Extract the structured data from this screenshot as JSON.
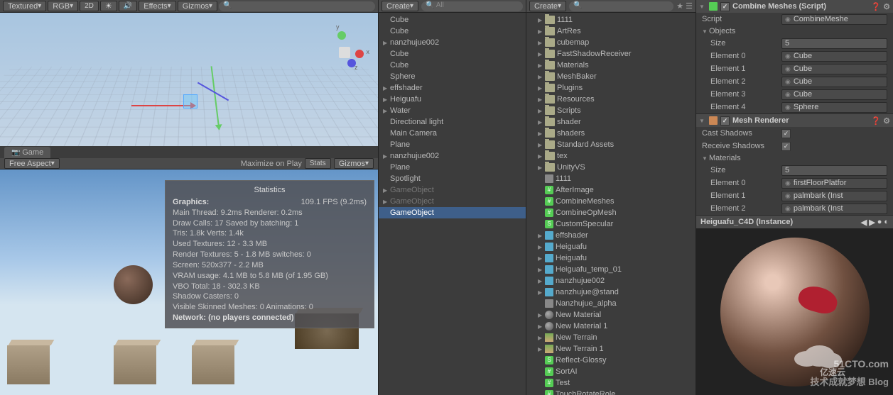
{
  "scene_toolbar": {
    "shading": "Textured",
    "render": "RGB",
    "dim": "2D",
    "effects": "Effects",
    "gizmos": "Gizmos",
    "search_ph": "All"
  },
  "game_tab": "Game",
  "game_toolbar": {
    "aspect": "Free Aspect",
    "maximize": "Maximize on Play",
    "stats": "Stats",
    "gizmos": "Gizmos"
  },
  "stats": {
    "title": "Statistics",
    "graphics_hdr": "Graphics:",
    "fps": "109.1 FPS (9.2ms)",
    "main_thread": "Main Thread: 9.2ms   Renderer: 0.2ms",
    "draw_calls": "Draw Calls: 17    Saved by batching: 1",
    "tris": "Tris: 1.8k    Verts: 1.4k",
    "textures": "Used Textures: 12 - 3.3 MB",
    "render_tex": "Render Textures: 5 - 1.8 MB  switches: 0",
    "screen": "Screen: 520x377 - 2.2 MB",
    "vram": "VRAM usage: 4.1 MB to 5.8 MB (of 1.95 GB)",
    "vbo": "VBO Total: 18 - 302.3 KB",
    "shadow": "Shadow Casters: 0",
    "skinned": "Visible Skinned Meshes: 0      Animations: 0",
    "network": "Network: (no players connected)"
  },
  "hier_create": "Create",
  "hierarchy": [
    {
      "n": "Cube",
      "a": ""
    },
    {
      "n": "Cube",
      "a": ""
    },
    {
      "n": "nanzhujue002",
      "a": "▶"
    },
    {
      "n": "Cube",
      "a": ""
    },
    {
      "n": "Cube",
      "a": ""
    },
    {
      "n": "Sphere",
      "a": ""
    },
    {
      "n": "effshader",
      "a": "▶"
    },
    {
      "n": "Heiguafu",
      "a": "▶"
    },
    {
      "n": "Water",
      "a": "▶"
    },
    {
      "n": "Directional light",
      "a": ""
    },
    {
      "n": "Main Camera",
      "a": ""
    },
    {
      "n": "Plane",
      "a": ""
    },
    {
      "n": "nanzhujue002",
      "a": "▶"
    },
    {
      "n": "Plane",
      "a": ""
    },
    {
      "n": "Spotlight",
      "a": ""
    },
    {
      "n": "GameObject",
      "a": "▶",
      "d": 1
    },
    {
      "n": "GameObject",
      "a": "▶",
      "d": 1
    },
    {
      "n": "GameObject",
      "a": "",
      "sel": 1
    }
  ],
  "proj_create": "Create",
  "project": [
    {
      "n": "1111",
      "t": "f",
      "a": "▶"
    },
    {
      "n": "ArtRes",
      "t": "f",
      "a": "▶"
    },
    {
      "n": "cubemap",
      "t": "f",
      "a": "▶"
    },
    {
      "n": "FastShadowReceiver",
      "t": "f",
      "a": "▶"
    },
    {
      "n": "Materials",
      "t": "f",
      "a": "▶"
    },
    {
      "n": "MeshBaker",
      "t": "f",
      "a": "▶"
    },
    {
      "n": "Plugins",
      "t": "f",
      "a": "▶"
    },
    {
      "n": "Resources",
      "t": "f",
      "a": "▶"
    },
    {
      "n": "Scripts",
      "t": "f",
      "a": "▶"
    },
    {
      "n": "shader",
      "t": "f",
      "a": "▶"
    },
    {
      "n": "shaders",
      "t": "f",
      "a": "▶"
    },
    {
      "n": "Standard Assets",
      "t": "f",
      "a": "▶"
    },
    {
      "n": "tex",
      "t": "f",
      "a": "▶"
    },
    {
      "n": "UnityVS",
      "t": "f",
      "a": "▶"
    },
    {
      "n": "1111",
      "t": "scene",
      "a": ""
    },
    {
      "n": "AfterImage",
      "t": "s",
      "a": ""
    },
    {
      "n": "CombineMeshes",
      "t": "s",
      "a": ""
    },
    {
      "n": "CombineOpMesh",
      "t": "s",
      "a": ""
    },
    {
      "n": "CustomSpecular",
      "t": "sh",
      "a": ""
    },
    {
      "n": "effshader",
      "t": "pf",
      "a": "▶"
    },
    {
      "n": "Heiguafu",
      "t": "pf",
      "a": "▶"
    },
    {
      "n": "Heiguafu",
      "t": "pf",
      "a": "▶"
    },
    {
      "n": "Heiguafu_temp_01",
      "t": "pf",
      "a": "▶"
    },
    {
      "n": "nanzhujue002",
      "t": "pf",
      "a": "▶"
    },
    {
      "n": "nanzhujue@stand",
      "t": "pf",
      "a": "▶"
    },
    {
      "n": "Nanzhujue_alpha",
      "t": "img",
      "a": ""
    },
    {
      "n": "New Material",
      "t": "mat",
      "a": "▶"
    },
    {
      "n": "New Material 1",
      "t": "mat",
      "a": "▶"
    },
    {
      "n": "New Terrain",
      "t": "ter",
      "a": "▶"
    },
    {
      "n": "New Terrain 1",
      "t": "ter",
      "a": "▶"
    },
    {
      "n": "Reflect-Glossy",
      "t": "sh",
      "a": ""
    },
    {
      "n": "SortAI",
      "t": "s",
      "a": ""
    },
    {
      "n": "Test",
      "t": "s",
      "a": ""
    },
    {
      "n": "TouchRotateRole",
      "t": "s",
      "a": ""
    }
  ],
  "inspector": {
    "comp1": {
      "title": "Combine Meshes (Script)",
      "script_lbl": "Script",
      "script_val": "CombineMeshe",
      "objects": "Objects",
      "size_lbl": "Size",
      "size_val": "5",
      "els": [
        [
          "Element 0",
          "Cube"
        ],
        [
          "Element 1",
          "Cube"
        ],
        [
          "Element 2",
          "Cube"
        ],
        [
          "Element 3",
          "Cube"
        ],
        [
          "Element 4",
          "Sphere"
        ]
      ]
    },
    "comp2": {
      "title": "Mesh Renderer",
      "cast_lbl": "Cast Shadows",
      "recv_lbl": "Receive Shadows",
      "materials": "Materials",
      "size_lbl": "Size",
      "size_val": "5",
      "els": [
        [
          "Element 0",
          "firstFloorPlatfor"
        ],
        [
          "Element 1",
          "palmbark (Inst"
        ],
        [
          "Element 2",
          "palmbark (Inst"
        ]
      ]
    },
    "mat_title": "Heiguafu_C4D (Instance)"
  },
  "watermark": {
    "l1": "51CTO.com",
    "l2": "技术成就梦想   Blog",
    "yy": "亿速云"
  }
}
